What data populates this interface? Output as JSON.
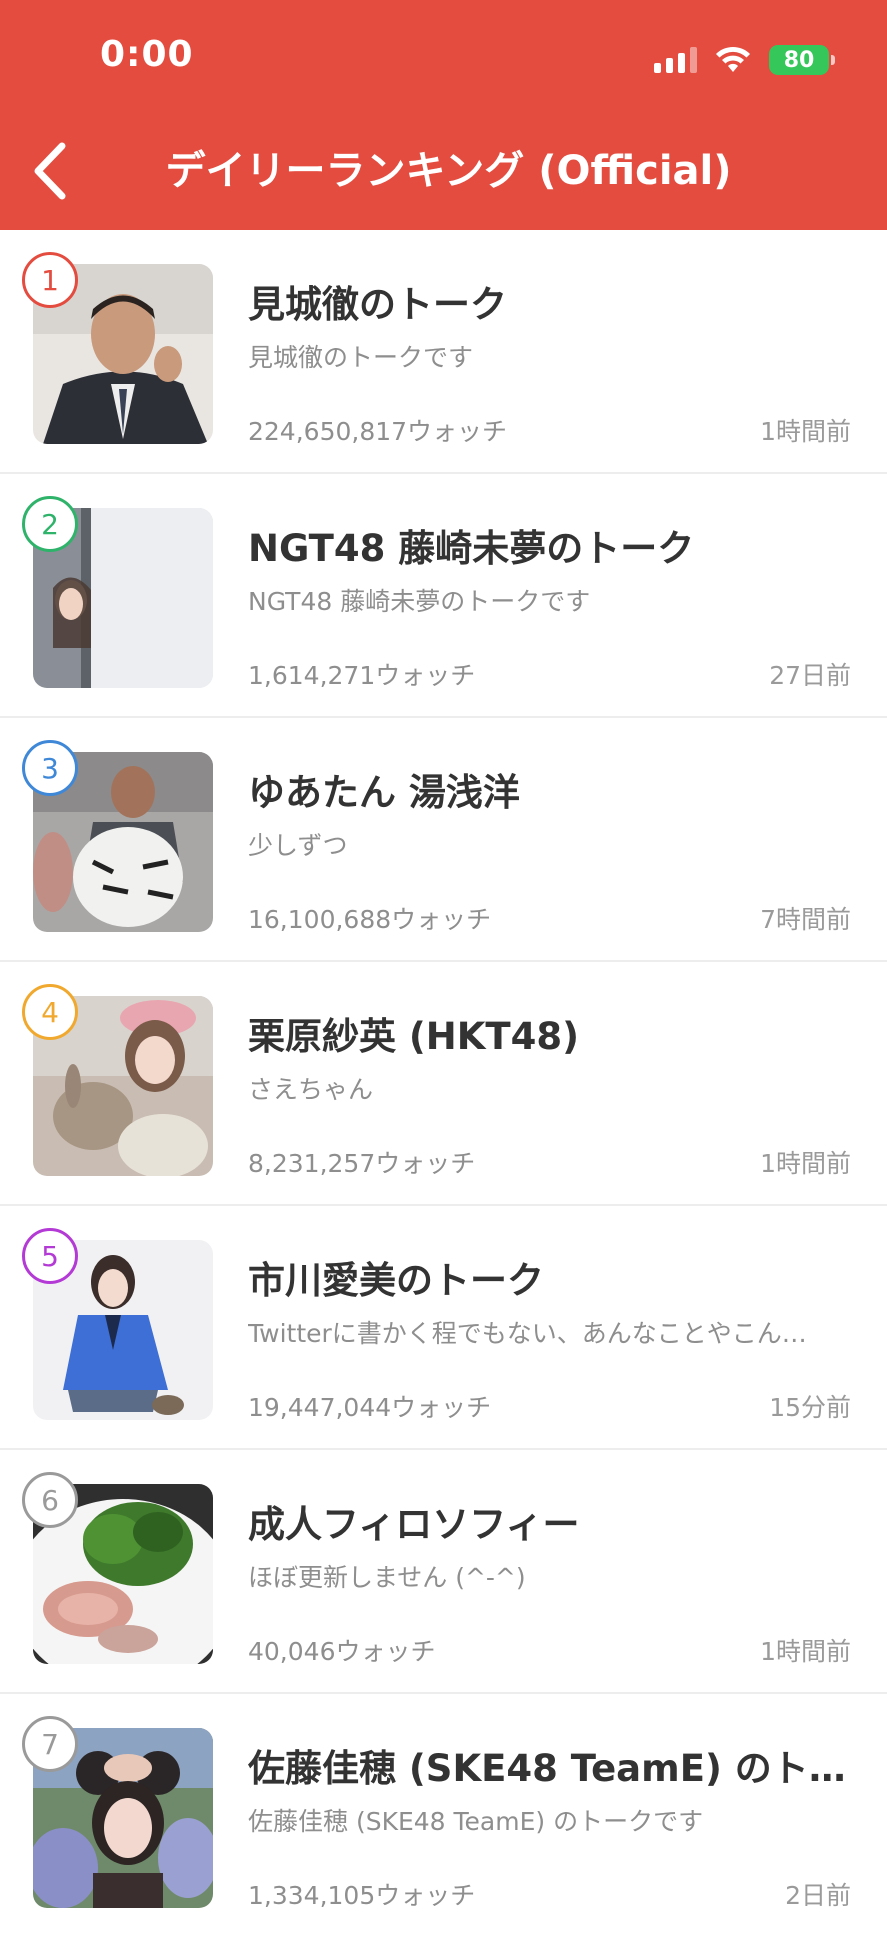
{
  "status_bar": {
    "time": "0:00",
    "battery": "80"
  },
  "nav": {
    "title": "デイリーランキング (Official)"
  },
  "colors": {
    "header": "#e34c3f"
  },
  "items": [
    {
      "rank": "1",
      "rank_color": "#e34c3f",
      "title": "見城徹のトーク",
      "description": "見城徹のトークです",
      "watch_count": "224,650,817",
      "watch_suffix": "ウォッチ",
      "time": "1時間前"
    },
    {
      "rank": "2",
      "rank_color": "#2fb36b",
      "title": "NGT48 藤崎未夢のトーク",
      "description": "NGT48 藤崎未夢のトークです",
      "watch_count": "1,614,271",
      "watch_suffix": "ウォッチ",
      "time": "27日前"
    },
    {
      "rank": "3",
      "rank_color": "#3f88d8",
      "title": "ゆあたん 湯浅洋",
      "description": "少しずつ",
      "watch_count": "16,100,688",
      "watch_suffix": "ウォッチ",
      "time": "7時間前"
    },
    {
      "rank": "4",
      "rank_color": "#f0a92e",
      "title": "栗原紗英 (HKT48)",
      "description": "さえちゃん",
      "watch_count": "8,231,257",
      "watch_suffix": "ウォッチ",
      "time": "1時間前"
    },
    {
      "rank": "5",
      "rank_color": "#b43ad6",
      "title": "市川愛美のトーク",
      "description": "Twitterに書かく程でもない、あんなことやこん…",
      "watch_count": "19,447,044",
      "watch_suffix": "ウォッチ",
      "time": "15分前"
    },
    {
      "rank": "6",
      "rank_color": "#9a9a9a",
      "title": "成人フィロソフィー",
      "description": "ほぼ更新しません (^-^)",
      "watch_count": "40,046",
      "watch_suffix": "ウォッチ",
      "time": "1時間前"
    },
    {
      "rank": "7",
      "rank_color": "#9a9a9a",
      "title": "佐藤佳穂 (SKE48 TeamE) のト…",
      "description": "佐藤佳穂 (SKE48 TeamE) のトークです",
      "watch_count": "1,334,105",
      "watch_suffix": "ウォッチ",
      "time": "2日前"
    }
  ]
}
